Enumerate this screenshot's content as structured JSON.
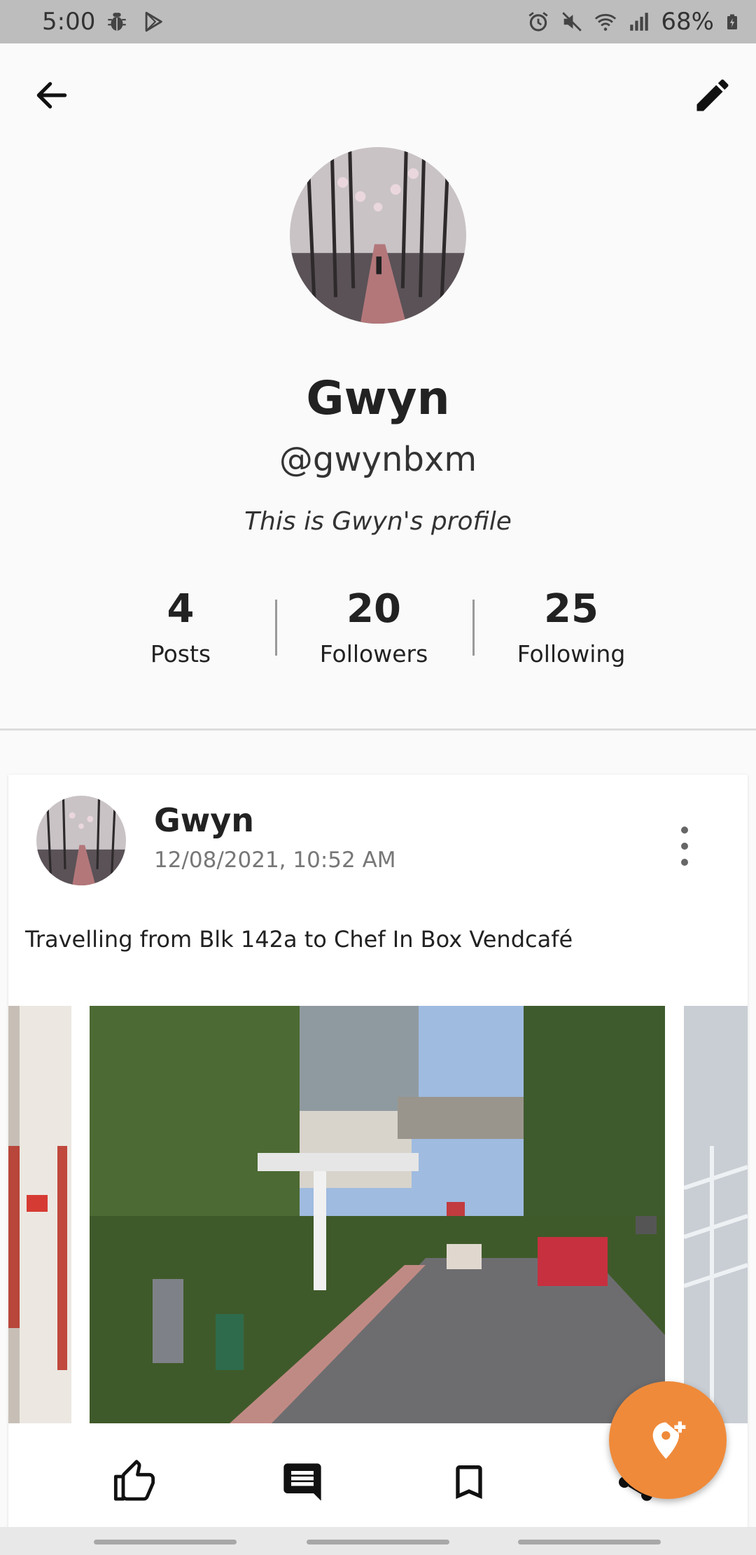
{
  "status_bar": {
    "time": "5:00",
    "battery": "68%",
    "icons_left": [
      "bug-icon",
      "play-store-icon"
    ],
    "icons_right": [
      "alarm-icon",
      "mute-icon",
      "wifi-icon",
      "signal-icon",
      "battery-charging-icon"
    ]
  },
  "app_bar": {
    "back_icon": "arrow-left-icon",
    "edit_icon": "pencil-icon"
  },
  "profile": {
    "name": "Gwyn",
    "handle": "@gwynbxm",
    "bio": "This is Gwyn's profile",
    "stats": [
      {
        "value": "4",
        "label": "Posts"
      },
      {
        "value": "20",
        "label": "Followers"
      },
      {
        "value": "25",
        "label": "Following"
      }
    ]
  },
  "post": {
    "author": "Gwyn",
    "timestamp": "12/08/2021, 10:52 AM",
    "text": "Travelling from Blk 142a to Chef In Box Vendcafé",
    "actions": [
      "thumb-up-icon",
      "comment-icon",
      "bookmark-icon",
      "share-icon"
    ]
  },
  "fab": {
    "icon": "add-location-icon"
  },
  "colors": {
    "accent": "#ef8a3a",
    "status_bar": "#bdbdbd",
    "background": "#fafafa"
  }
}
